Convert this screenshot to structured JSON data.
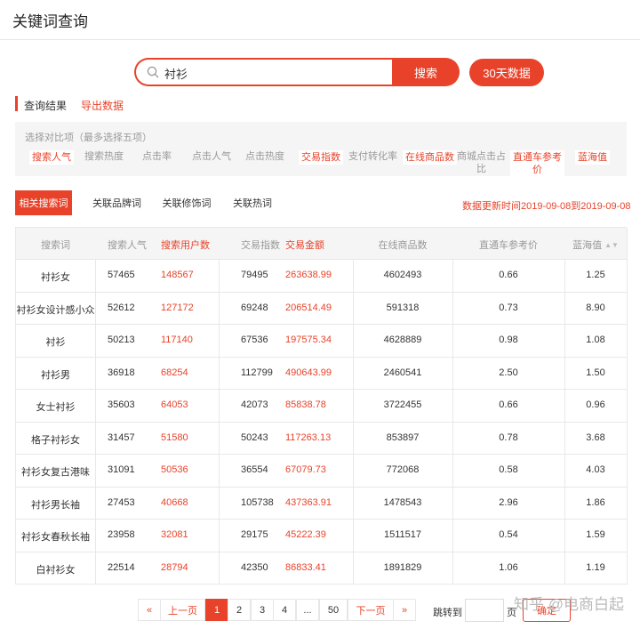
{
  "page_title": "关键词查询",
  "search": {
    "value": "衬衫",
    "button": "搜索",
    "days_button": "30天数据"
  },
  "result": {
    "label": "查询结果",
    "export": "导出数据"
  },
  "filter": {
    "hint": "选择对比项（最多选择五项）",
    "metrics": [
      {
        "label": "搜索人气",
        "selected": true
      },
      {
        "label": "搜索热度",
        "selected": false
      },
      {
        "label": "点击率",
        "selected": false
      },
      {
        "label": "点击人气",
        "selected": false
      },
      {
        "label": "点击热度",
        "selected": false
      },
      {
        "label": "交易指数",
        "selected": true
      },
      {
        "label": "支付转化率",
        "selected": false
      },
      {
        "label": "在线商品数",
        "selected": true
      },
      {
        "label": "商城点击占",
        "label_line2": "比",
        "selected": false
      },
      {
        "label": "直通车参考",
        "label_line2": "价",
        "selected": true
      },
      {
        "label": "蓝海值",
        "selected": true
      }
    ]
  },
  "tabs": [
    {
      "label": "相关搜索词",
      "active": true
    },
    {
      "label": "关联品牌词",
      "active": false
    },
    {
      "label": "关联修饰词",
      "active": false
    },
    {
      "label": "关联热词",
      "active": false
    }
  ],
  "update_time": "数据更新时间2019-09-08到2019-09-08",
  "table": {
    "headers": [
      "搜索词",
      "搜索人气",
      "搜索用户数",
      "交易指数",
      "交易金额",
      "在线商品数",
      "直通车参考价",
      "蓝海值"
    ],
    "rows": [
      [
        "衬衫女",
        "57465",
        "148567",
        "79495",
        "263638.99",
        "4602493",
        "0.66",
        "1.25"
      ],
      [
        "衬衫女设计感小众",
        "52612",
        "127172",
        "69248",
        "206514.49",
        "591318",
        "0.73",
        "8.90"
      ],
      [
        "衬衫",
        "50213",
        "117140",
        "67536",
        "197575.34",
        "4628889",
        "0.98",
        "1.08"
      ],
      [
        "衬衫男",
        "36918",
        "68254",
        "112799",
        "490643.99",
        "2460541",
        "2.50",
        "1.50"
      ],
      [
        "女士衬衫",
        "35603",
        "64053",
        "42073",
        "85838.78",
        "3722455",
        "0.66",
        "0.96"
      ],
      [
        "格子衬衫女",
        "31457",
        "51580",
        "50243",
        "117263.13",
        "853897",
        "0.78",
        "3.68"
      ],
      [
        "衬衫女复古港味",
        "31091",
        "50536",
        "36554",
        "67079.73",
        "772068",
        "0.58",
        "4.03"
      ],
      [
        "衬衫男长袖",
        "27453",
        "40668",
        "105738",
        "437363.91",
        "1478543",
        "2.96",
        "1.86"
      ],
      [
        "衬衫女春秋长袖",
        "23958",
        "32081",
        "29175",
        "45222.39",
        "1511517",
        "0.54",
        "1.59"
      ],
      [
        "白衬衫女",
        "22514",
        "28794",
        "42350",
        "86833.41",
        "1891829",
        "1.06",
        "1.19"
      ]
    ]
  },
  "pager": {
    "first": "«",
    "prev": "上一页",
    "pages": [
      "1",
      "2",
      "3",
      "4",
      "...",
      "50"
    ],
    "current": "1",
    "next": "下一页",
    "last": "»",
    "jump_label": "跳转到",
    "page_unit": "页",
    "confirm": "确定"
  },
  "watermark": "知乎 @电商白起"
}
